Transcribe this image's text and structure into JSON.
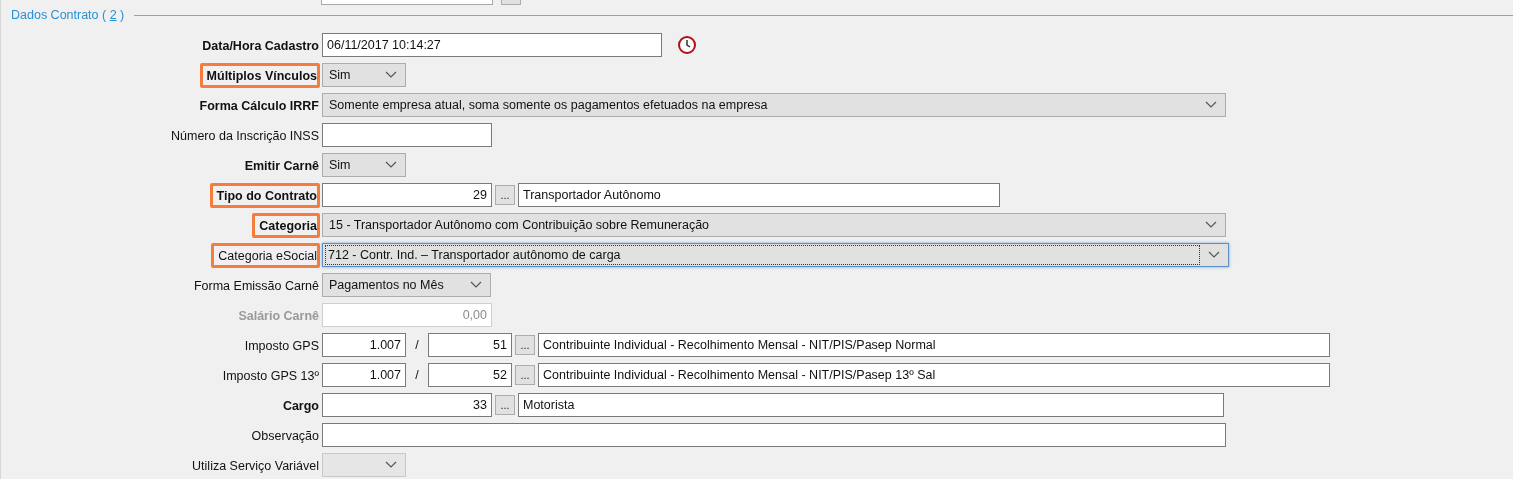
{
  "section": {
    "prefix": "Dados Contrato (",
    "accesskey": "2",
    "suffix": ")"
  },
  "rows": [
    {
      "kind": "datetime",
      "label": "Data/Hora Cadastro",
      "bold": true,
      "highlighted": false,
      "disabled": false,
      "value": "06/11/2017 10:14:27"
    },
    {
      "kind": "select",
      "label": "Múltiplos Vínculos",
      "bold": true,
      "highlighted": true,
      "disabled": false,
      "value": "Sim"
    },
    {
      "kind": "select",
      "label": "Forma Cálculo IRRF",
      "bold": true,
      "highlighted": false,
      "disabled": false,
      "value": "Somente empresa atual, soma somente os pagamentos efetuados na empresa"
    },
    {
      "kind": "text",
      "label": "Número da Inscrição INSS",
      "bold": false,
      "highlighted": false,
      "disabled": false
    },
    {
      "kind": "select",
      "label": "Emitir Carnê",
      "bold": true,
      "highlighted": false,
      "disabled": false,
      "value": "Sim"
    },
    {
      "kind": "lookup",
      "label": "Tipo do Contrato",
      "bold": true,
      "highlighted": true,
      "disabled": false,
      "code": "29",
      "button": "...",
      "description": "Transportador Autônomo"
    },
    {
      "kind": "select",
      "label": "Categoria",
      "bold": true,
      "highlighted": true,
      "disabled": false,
      "value": "15 - Transportador Autônomo com Contribuição sobre Remuneração"
    },
    {
      "kind": "select",
      "label": "Categoria eSocial",
      "bold": false,
      "highlighted": true,
      "disabled": false,
      "focused": true,
      "value": "712 - Contr. Ind. – Transportador autônomo de carga"
    },
    {
      "kind": "select",
      "label": "Forma Emissão Carnê",
      "bold": false,
      "highlighted": false,
      "disabled": false,
      "value": "Pagamentos no Mês"
    },
    {
      "kind": "number",
      "label": "Salário Carnê",
      "bold": true,
      "highlighted": false,
      "disabled": true,
      "value": "0,00"
    },
    {
      "kind": "gps",
      "label": "Imposto GPS",
      "bold": false,
      "highlighted": false,
      "disabled": false,
      "code": "1.007",
      "separator": "/",
      "subcode": "51",
      "button": "...",
      "description": "Contribuinte Individual - Recolhimento Mensal - NIT/PIS/Pasep Normal"
    },
    {
      "kind": "gps",
      "label": "Imposto GPS 13º",
      "bold": false,
      "highlighted": false,
      "disabled": false,
      "code": "1.007",
      "separator": "/",
      "subcode": "52",
      "button": "...",
      "description": "Contribuinte Individual - Recolhimento Mensal - NIT/PIS/Pasep 13º Sal"
    },
    {
      "kind": "lookup",
      "label": "Cargo",
      "bold": true,
      "highlighted": false,
      "disabled": false,
      "code": "33",
      "button": "...",
      "description": "Motorista"
    },
    {
      "kind": "text",
      "label": "Observação",
      "bold": false,
      "highlighted": false,
      "disabled": false
    },
    {
      "kind": "select",
      "label": "Utiliza Serviço Variável",
      "bold": false,
      "highlighted": false,
      "disabled": true
    }
  ]
}
